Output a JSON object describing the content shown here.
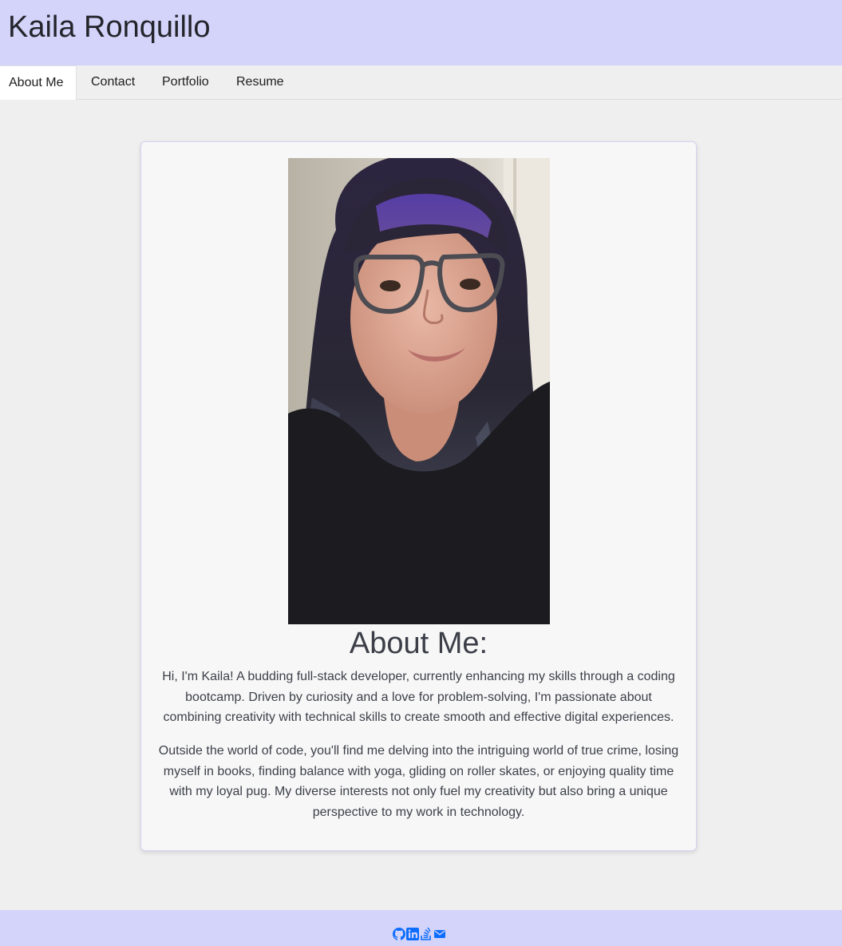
{
  "header": {
    "title": "Kaila Ronquillo"
  },
  "nav": {
    "tabs": [
      {
        "label": "About Me",
        "active": true
      },
      {
        "label": "Contact",
        "active": false
      },
      {
        "label": "Portfolio",
        "active": false
      },
      {
        "label": "Resume",
        "active": false
      }
    ]
  },
  "about": {
    "heading": "About Me:",
    "paragraph_1": "Hi, I'm Kaila! A budding full-stack developer, currently enhancing my skills through a coding bootcamp. Driven by curiosity and a love for problem-solving, I'm passionate about combining creativity with technical skills to create smooth and effective digital experiences.",
    "paragraph_2": "Outside the world of code, you'll find me delving into the intriguing world of true crime, losing myself in books, finding balance with yoga, gliding on roller skates, or enjoying quality time with my loyal pug. My diverse interests not only fuel my creativity but also bring a unique perspective to my work in technology."
  },
  "footer": {
    "icons": [
      "github-icon",
      "linkedin-icon",
      "stackoverflow-icon",
      "email-icon"
    ]
  },
  "colors": {
    "header_bg": "#d4d4fb",
    "page_bg": "#efefef",
    "card_bg": "#f7f7f7",
    "icon_blue": "#0d6efd"
  }
}
